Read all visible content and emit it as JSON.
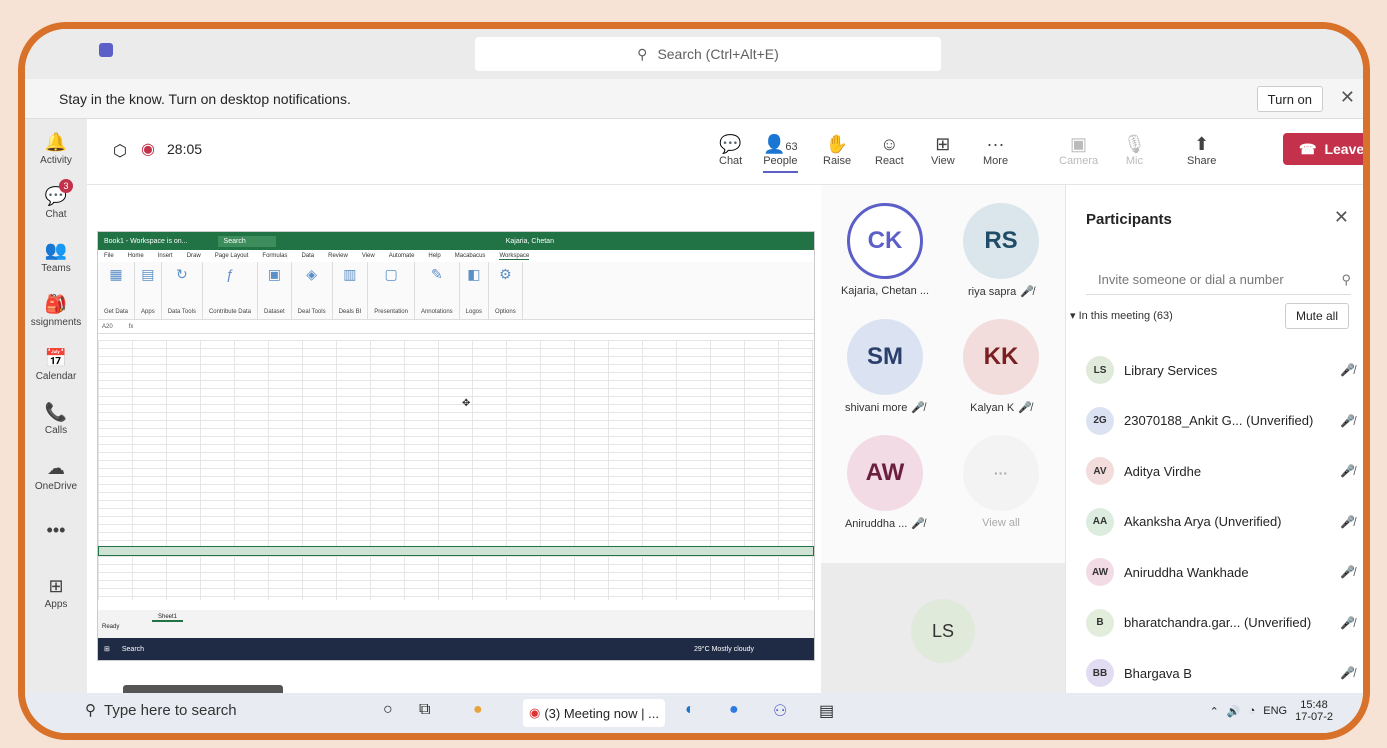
{
  "topbar": {
    "search_placeholder": "Search (Ctrl+Alt+E)"
  },
  "notification": {
    "text": "Stay in the know. Turn on desktop notifications.",
    "button": "Turn on"
  },
  "rail": [
    {
      "label": "Activity",
      "icon": "bell-icon",
      "glyph": "🔔"
    },
    {
      "label": "Chat",
      "icon": "chat-icon",
      "glyph": "💬",
      "badge": "3"
    },
    {
      "label": "Teams",
      "icon": "teams-icon",
      "glyph": "👥"
    },
    {
      "label": "ssignments",
      "icon": "assignments-icon",
      "glyph": "🎒"
    },
    {
      "label": "Calendar",
      "icon": "calendar-icon",
      "glyph": "📅"
    },
    {
      "label": "Calls",
      "icon": "phone-icon",
      "glyph": "📞"
    },
    {
      "label": "OneDrive",
      "icon": "cloud-icon",
      "glyph": "☁"
    },
    {
      "label": "",
      "icon": "more-icon",
      "glyph": "•••"
    },
    {
      "label": "Apps",
      "icon": "apps-icon",
      "glyph": "⊞"
    }
  ],
  "meeting": {
    "timer": "28:05",
    "controls": {
      "chat": "Chat",
      "people": "People",
      "people_count": "63",
      "raise": "Raise",
      "react": "React",
      "view": "View",
      "more": "More",
      "camera": "Camera",
      "mic": "Mic",
      "share": "Share",
      "leave": "Leave"
    }
  },
  "excel": {
    "title": "Book1 - Workspace is on...",
    "search": "Search",
    "user": "Kajaria, Chetan",
    "menu": [
      "File",
      "Home",
      "Insert",
      "Draw",
      "Page Layout",
      "Formulas",
      "Data",
      "Review",
      "View",
      "Automate",
      "Help",
      "Macabacus",
      "Workspace"
    ],
    "groups": [
      "Get Data",
      "Apps",
      "Data Tools",
      "Contribute Data",
      "Dataset",
      "Deal Tools",
      "Deals BI",
      "Presentation",
      "Annotations",
      "Logos",
      "Options"
    ],
    "cell_ref": "A20",
    "sheet": "Sheet1",
    "status": "Ready",
    "weather": "29°C Mostly cloudy",
    "win_search": "Search"
  },
  "name_tag": "Kajaria, Chetan (Unverified)",
  "gallery": [
    {
      "initials": "CK",
      "name": "Kajaria, Chetan ...",
      "muted": false,
      "bg": "#ffffff",
      "fg": "#5b5fc7"
    },
    {
      "initials": "RS",
      "name": "riya sapra",
      "muted": true,
      "bg": "#dbe6ec",
      "fg": "#1f4c66"
    },
    {
      "initials": "SM",
      "name": "shivani more",
      "muted": true,
      "bg": "#dbe3f3",
      "fg": "#2b3f6b"
    },
    {
      "initials": "KK",
      "name": "Kalyan K",
      "muted": true,
      "bg": "#f3dcdc",
      "fg": "#7a1f1f"
    },
    {
      "initials": "AW",
      "name": "Aniruddha ...",
      "muted": true,
      "bg": "#f3dbe6",
      "fg": "#6b1f3f"
    },
    {
      "initials": "···",
      "name": "View all",
      "muted": false,
      "bg": "#f3f3f3",
      "fg": "#aaaaaa"
    }
  ],
  "ls_tile": "LS",
  "participants": {
    "title": "Participants",
    "invite": "Invite someone or dial a number",
    "in_meeting": "In this meeting (63)",
    "mute_all": "Mute all",
    "list": [
      {
        "initials": "LS",
        "name": "Library Services",
        "bg": "#e0eadb"
      },
      {
        "initials": "2G",
        "name": "23070188_Ankit G... (Unverified)",
        "bg": "#dbe3f3"
      },
      {
        "initials": "AV",
        "name": "Aditya Virdhe",
        "bg": "#f3dcdc"
      },
      {
        "initials": "AA",
        "name": "Akanksha Arya (Unverified)",
        "bg": "#dcecde"
      },
      {
        "initials": "AW",
        "name": "Aniruddha Wankhade",
        "bg": "#f3dbe6"
      },
      {
        "initials": "B",
        "name": "bharatchandra.gar... (Unverified)",
        "bg": "#e3eddc"
      },
      {
        "initials": "BB",
        "name": "Bhargava B",
        "bg": "#e2dcf3"
      }
    ]
  },
  "taskbar": {
    "search": "Type here to search",
    "chip": "(3) Meeting now | ...",
    "lang": "ENG",
    "time": "15:48",
    "date": "17-07-2"
  }
}
